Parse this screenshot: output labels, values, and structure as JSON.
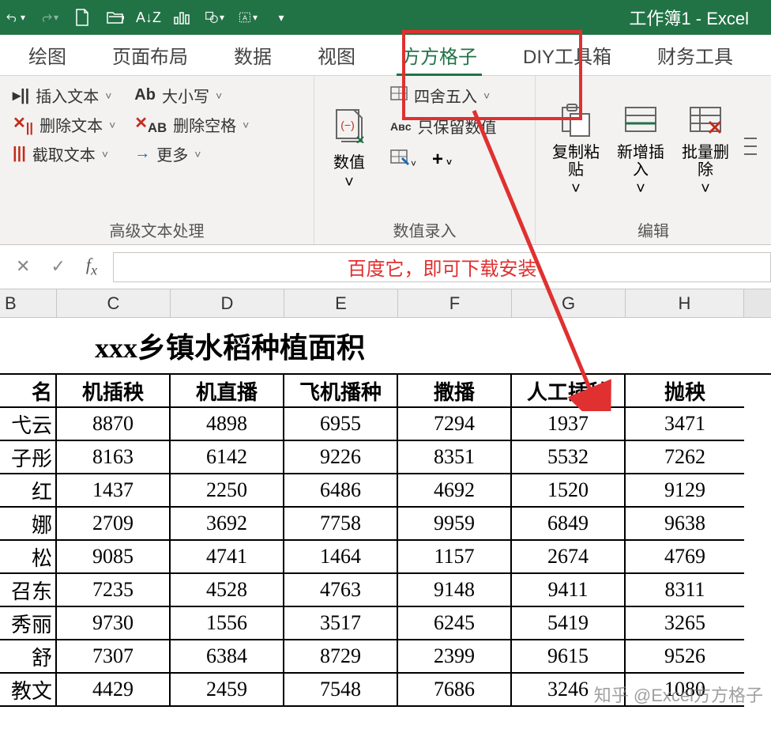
{
  "titlebar": {
    "title": "工作簿1  -  Excel"
  },
  "tabs": {
    "items": [
      "绘图",
      "页面布局",
      "数据",
      "视图",
      "方方格子",
      "DIY工具箱",
      "财务工具"
    ],
    "active_index": 4
  },
  "ribbon": {
    "group1": {
      "label": "高级文本处理",
      "col1": {
        "a": "插入文本",
        "b": "删除文本",
        "c": "截取文本"
      },
      "col2": {
        "a": "大小写",
        "b": "删除空格",
        "c": "更多"
      }
    },
    "group2": {
      "label": "数值录入",
      "numeric": "数值",
      "round": "四舍五入",
      "keep": "只保留数值"
    },
    "group3": {
      "label": "编辑",
      "copy": "复制粘贴",
      "insert": "新增插入",
      "delete": "批量删除"
    }
  },
  "formula_bar": {
    "text": "百度它，即可下载安装"
  },
  "columns": [
    "B",
    "C",
    "D",
    "E",
    "F",
    "G",
    "H"
  ],
  "sheet": {
    "title": "xxx乡镇水稻种植面积",
    "headers": [
      "名",
      "机插秧",
      "机直播",
      "飞机播种",
      "撒播",
      "人工插秧",
      "抛秧"
    ],
    "rows": [
      [
        "弋云",
        "8870",
        "4898",
        "6955",
        "7294",
        "1937",
        "3471"
      ],
      [
        "子彤",
        "8163",
        "6142",
        "9226",
        "8351",
        "5532",
        "7262"
      ],
      [
        "红",
        "1437",
        "2250",
        "6486",
        "4692",
        "1520",
        "9129"
      ],
      [
        "娜",
        "2709",
        "3692",
        "7758",
        "9959",
        "6849",
        "9638"
      ],
      [
        "松",
        "9085",
        "4741",
        "1464",
        "1157",
        "2674",
        "4769"
      ],
      [
        "召东",
        "7235",
        "4528",
        "4763",
        "9148",
        "9411",
        "8311"
      ],
      [
        "秀丽",
        "9730",
        "1556",
        "3517",
        "6245",
        "5419",
        "3265"
      ],
      [
        "舒",
        "7307",
        "6384",
        "8729",
        "2399",
        "9615",
        "9526"
      ],
      [
        "教文",
        "4429",
        "2459",
        "7548",
        "7686",
        "3246",
        "1080"
      ]
    ]
  },
  "watermark": "知乎 @Excel方方格子"
}
